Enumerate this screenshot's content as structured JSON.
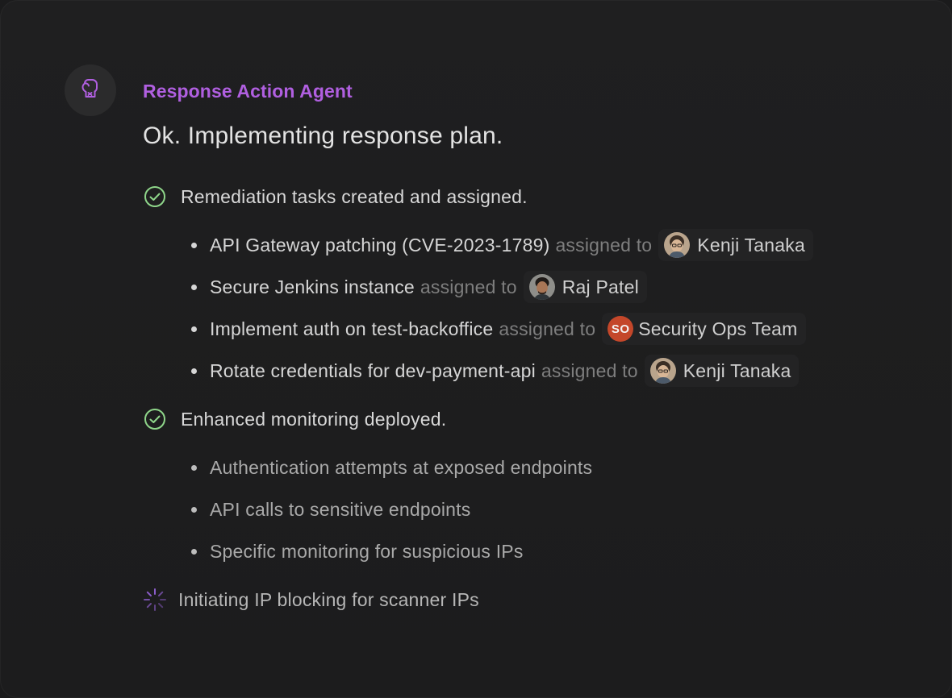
{
  "agent": {
    "name": "Response Action Agent",
    "icon": "boxing-glove-icon",
    "accent_color": "#b05fe0"
  },
  "headline": "Ok. Implementing response plan.",
  "steps": [
    {
      "status": "done",
      "label": "Remediation tasks created and assigned.",
      "items": [
        {
          "text": "API Gateway patching (CVE-2023-1789)",
          "assigned_label": "assigned to",
          "assignee": "Kenji Tanaka",
          "avatar": "kenji-avatar"
        },
        {
          "text": "Secure Jenkins instance",
          "assigned_label": "assigned to",
          "assignee": "Raj Patel",
          "avatar": "raj-avatar"
        },
        {
          "text": "Implement auth on test-backoffice",
          "assigned_label": "assigned to",
          "assignee": "Security Ops Team",
          "avatar_initials": "SO",
          "avatar_color": "#c4472a"
        },
        {
          "text": "Rotate credentials for dev-payment-api",
          "assigned_label": "assigned to",
          "assignee": "Kenji Tanaka",
          "avatar": "kenji-avatar"
        }
      ]
    },
    {
      "status": "done",
      "label": "Enhanced monitoring deployed.",
      "items": [
        {
          "text": "Authentication attempts at exposed endpoints"
        },
        {
          "text": "API calls to sensitive endpoints"
        },
        {
          "text": "Specific monitoring for suspicious IPs"
        }
      ]
    },
    {
      "status": "in-progress",
      "label": "Initiating IP blocking for scanner IPs"
    }
  ],
  "colors": {
    "check": "#8fd68a",
    "spinner": "#8a5cc8"
  }
}
